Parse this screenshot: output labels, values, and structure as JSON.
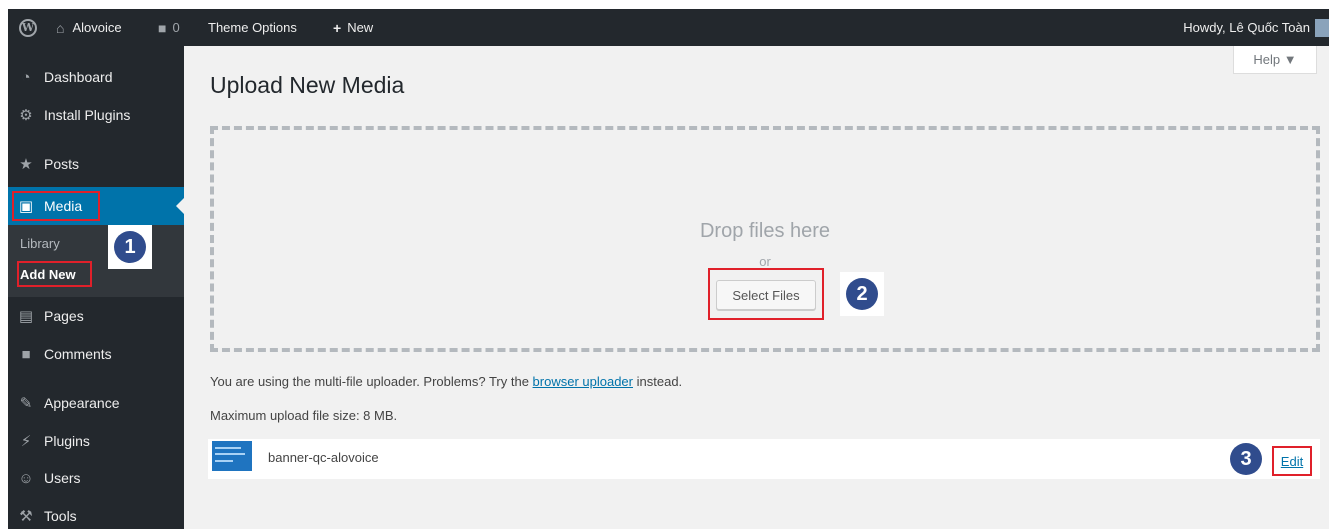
{
  "adminbar": {
    "site_name": "Alovoice",
    "comments_count": "0",
    "theme_options": "Theme Options",
    "new_label": "New",
    "howdy": "Howdy, Lê Quốc Toàn"
  },
  "sidebar": {
    "items": [
      {
        "label": "Dashboard",
        "icon": "dashboard-icon"
      },
      {
        "label": "Install Plugins",
        "icon": "gear-icon"
      },
      {
        "label": "Posts",
        "icon": "pin-icon"
      },
      {
        "label": "Media",
        "icon": "media-icon"
      },
      {
        "label": "Pages",
        "icon": "pages-icon"
      },
      {
        "label": "Comments",
        "icon": "comment-icon"
      },
      {
        "label": "Appearance",
        "icon": "brush-icon"
      },
      {
        "label": "Plugins",
        "icon": "plug-icon"
      },
      {
        "label": "Users",
        "icon": "user-icon"
      },
      {
        "label": "Tools",
        "icon": "wrench-icon"
      }
    ],
    "submenu": [
      "Library",
      "Add New"
    ]
  },
  "help": "Help ▼",
  "page_title": "Upload New Media",
  "uploader": {
    "drop_text": "Drop files here",
    "or_text": "or",
    "select_button": "Select Files"
  },
  "info": {
    "multi_prefix": "You are using the multi-file uploader. Problems? Try the",
    "browser_uploader_link": "browser uploader",
    "multi_suffix": "instead.",
    "max_size": "Maximum upload file size: 8 MB."
  },
  "media_item": {
    "filename": "banner-qc-alovoice",
    "edit_label": "Edit"
  },
  "callouts": [
    "1",
    "2",
    "3"
  ],
  "colors": {
    "adminbar": "#23282d",
    "current_menu": "#0073aa",
    "highlight_box": "#e0202a",
    "callout_circle": "#304c8d",
    "link": "#0073aa"
  }
}
